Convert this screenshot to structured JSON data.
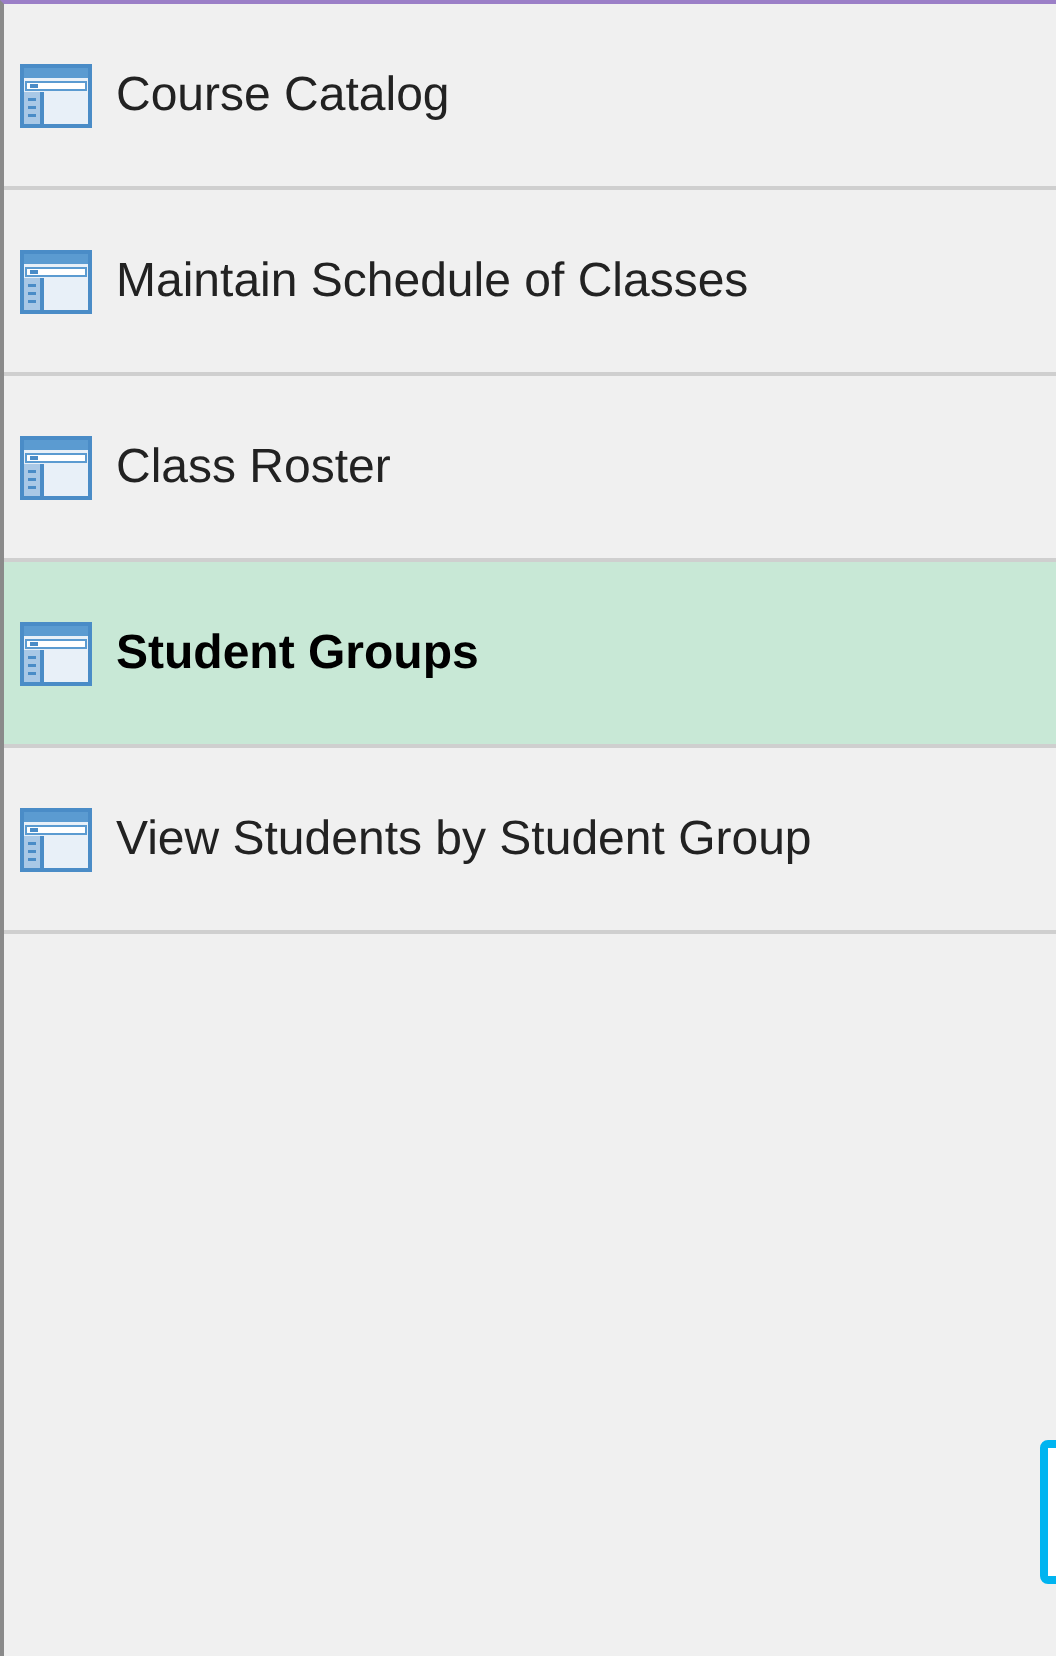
{
  "menu_items": [
    {
      "label": "Course Catalog",
      "selected": false
    },
    {
      "label": "Maintain Schedule of Classes",
      "selected": false
    },
    {
      "label": "Class Roster",
      "selected": false
    },
    {
      "label": "Student Groups",
      "selected": true
    },
    {
      "label": "View Students by Student Group",
      "selected": false
    }
  ]
}
